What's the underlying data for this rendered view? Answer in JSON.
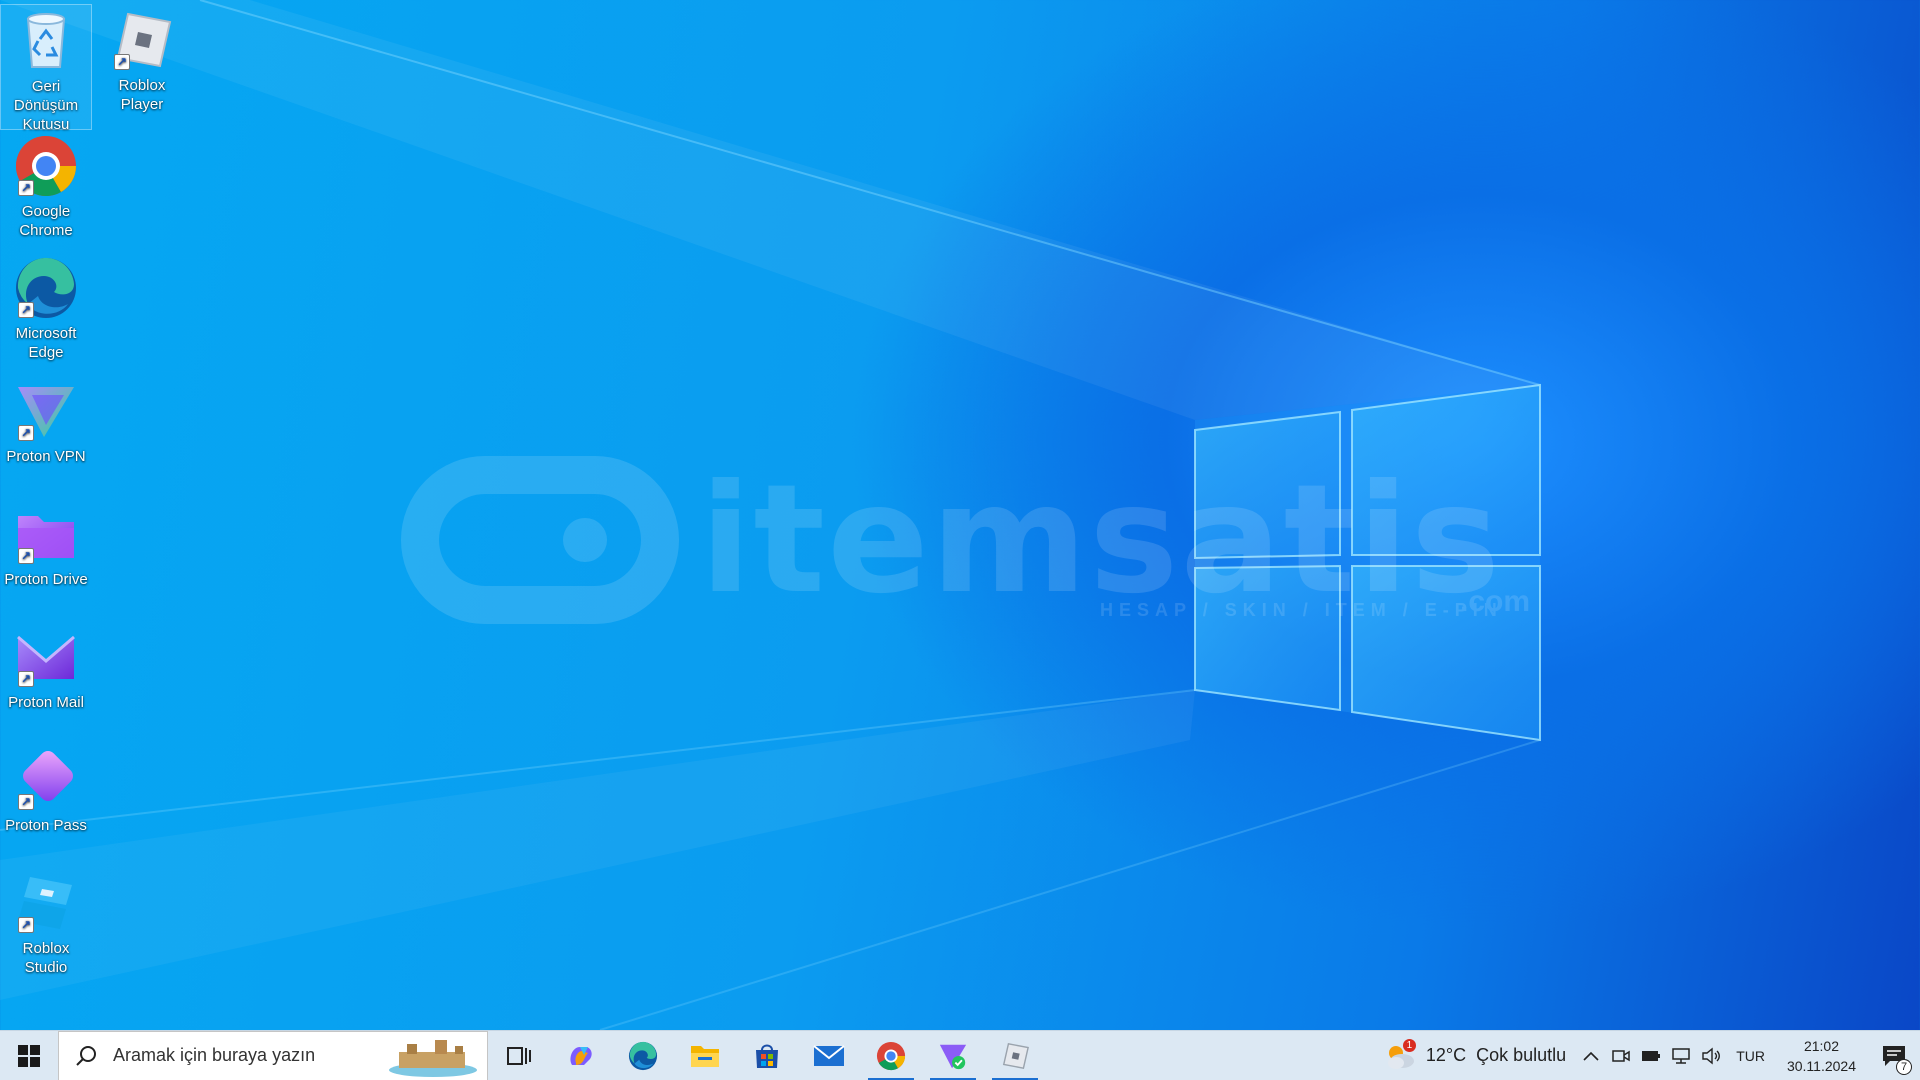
{
  "desktop": {
    "icons": [
      {
        "label": "Geri Dönüşüm Kutusu",
        "icon": "recycle-bin-icon"
      },
      {
        "label": "Roblox Player",
        "icon": "roblox-player-icon"
      },
      {
        "label": "Google Chrome",
        "icon": "chrome-icon"
      },
      {
        "label": "Microsoft Edge",
        "icon": "edge-icon"
      },
      {
        "label": "Proton VPN",
        "icon": "proton-vpn-icon"
      },
      {
        "label": "Proton Drive",
        "icon": "proton-drive-icon"
      },
      {
        "label": "Proton Mail",
        "icon": "proton-mail-icon"
      },
      {
        "label": "Proton Pass",
        "icon": "proton-pass-icon"
      },
      {
        "label": "Roblox Studio",
        "icon": "roblox-studio-icon"
      }
    ]
  },
  "watermark": {
    "brand": "itemsatis",
    "tagline": "HESAP / SKIN / ITEM / E-PIN",
    "suffix": ".com"
  },
  "taskbar": {
    "search_placeholder": "Aramak için buraya yazın",
    "apps": [
      "task-view-icon",
      "copilot-icon",
      "edge-icon",
      "file-explorer-icon",
      "microsoft-store-icon",
      "mail-icon",
      "chrome-icon",
      "proton-vpn-icon",
      "roblox-icon"
    ],
    "weather": {
      "temp": "12°C",
      "condition": "Çok bulutlu",
      "badge": "1"
    },
    "language": "TUR",
    "time": "21:02",
    "date": "30.11.2024",
    "notification_count": "7"
  }
}
